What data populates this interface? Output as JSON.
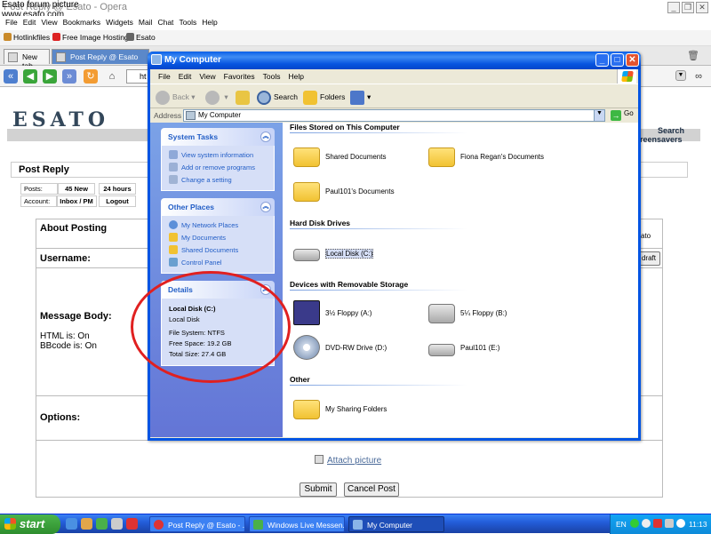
{
  "watermark": {
    "line1": "Esato forum picture",
    "line2": "www.esato.com"
  },
  "opera": {
    "title": "Post Reply @ Esato - Opera",
    "menu": [
      "File",
      "Edit",
      "View",
      "Bookmarks",
      "Widgets",
      "Mail",
      "Chat",
      "Tools",
      "Help"
    ],
    "personal_bar": [
      "Hotlinkfiles",
      "Free Image Hosting",
      "Esato"
    ],
    "tabs": [
      "New tab",
      "Post Reply @ Esato"
    ],
    "address_partial": "ht"
  },
  "page": {
    "logo": "ESATO",
    "nav_right": [
      "Search",
      "reensavers"
    ],
    "post_reply": "Post Reply",
    "account_rows": [
      {
        "label": "Posts:",
        "a": "45 New",
        "b": "24 hours"
      },
      {
        "label": "Account:",
        "a": "Inbox / PM",
        "b": "Logout"
      }
    ],
    "about_posting": "About Posting",
    "right_text": "ato",
    "username": "Username:",
    "draft": "draft",
    "message_body": "Message Body:",
    "html_on": "HTML is:  On",
    "bbcode_on": "BBcode is:  On",
    "options": "Options:",
    "attach_picture": "Attach picture",
    "submit": "Submit",
    "cancel_post": "Cancel Post"
  },
  "explorer": {
    "title": "My Computer",
    "menu": [
      "File",
      "Edit",
      "View",
      "Favorites",
      "Tools",
      "Help"
    ],
    "toolbar": {
      "back": "Back",
      "search": "Search",
      "folders": "Folders"
    },
    "address_label": "Address",
    "address_value": "My Computer",
    "go": "Go",
    "system_tasks": {
      "title": "System Tasks",
      "items": [
        "View system information",
        "Add or remove programs",
        "Change a setting"
      ]
    },
    "other_places": {
      "title": "Other Places",
      "items": [
        "My Network Places",
        "My Documents",
        "Shared Documents",
        "Control Panel"
      ]
    },
    "details": {
      "title": "Details",
      "name": "Local Disk (C:)",
      "type": "Local Disk",
      "file_system": "File System: NTFS",
      "free_space": "Free Space: 19.2 GB",
      "total_size": "Total Size: 27.4 GB"
    },
    "sections": {
      "files_stored": "Files Stored on This Computer",
      "hard_disk": "Hard Disk Drives",
      "removable": "Devices with Removable Storage",
      "other": "Other"
    },
    "files": [
      "Shared Documents",
      "Fiona Regan's Documents",
      "Paul101's Documents"
    ],
    "hard_disks": [
      "Local Disk (C:)"
    ],
    "removable": [
      "3½ Floppy (A:)",
      "5¼ Floppy (B:)",
      "DVD-RW Drive (D:)",
      "Paul101 (E:)"
    ],
    "other": [
      "My Sharing Folders"
    ]
  },
  "taskbar": {
    "start": "start",
    "tasks": [
      "Post Reply @ Esato - ...",
      "Windows Live Messen...",
      "My Computer"
    ],
    "lang": "EN",
    "clock": "11:13"
  }
}
